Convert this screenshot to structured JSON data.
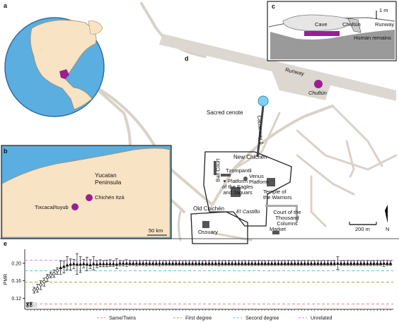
{
  "panels": {
    "a": "a",
    "b": "b",
    "c": "c",
    "d": "d",
    "e": "e"
  },
  "map_d": {
    "runway": "Runway",
    "chultun": "Chultún",
    "sacred_cenote": "Sacred cenote",
    "causeway": "Causeway 1",
    "new_chichen": "New Chichén",
    "tzompantli": "Tzompantli",
    "ball_court": "Ball Court",
    "eagles": [
      "Platform",
      "of the Eagles",
      "and Jaguars"
    ],
    "venus": [
      "Venus",
      "Platform"
    ],
    "warriors": [
      "Temple of",
      "the Warriors"
    ],
    "el_castillo": "El Castillo",
    "thousand": [
      "Court of the",
      "Thousand",
      "Columns"
    ],
    "old_chichen": "Old Chichén",
    "market": "Market",
    "ossuary": "Ossuary",
    "scale": "200 m",
    "north": "N"
  },
  "map_b": {
    "yucatan": [
      "Yucatan",
      "Peninsula"
    ],
    "chichen": "Chichén Itzá",
    "tixcaca": "Tixcacal/tuyub",
    "scale": "50 km"
  },
  "map_c": {
    "scale": "1 m",
    "cave": "Cave",
    "chultun": "Chultún",
    "runway": "Runway",
    "human_remains": "Human remains"
  },
  "colors": {
    "purple": "#9b1f91",
    "land": "#f9e3c5",
    "water": "#6bbde5",
    "road": "#d9d2c9",
    "gray": "#9a9a9a"
  },
  "chart_data": {
    "type": "scatter",
    "ylabel": "PMR",
    "yticks": [
      0.12,
      0.16,
      0.2
    ],
    "ylim": [
      0.095,
      0.232
    ],
    "thresholds": [
      {
        "name": "Same/Twins",
        "value": 0.107,
        "color": "#f08080"
      },
      {
        "name": "First degree",
        "value": 0.157,
        "color": "#a8a832"
      },
      {
        "name": "Second degree",
        "value": 0.183,
        "color": "#4fc7c7"
      },
      {
        "name": "Unrelated",
        "value": 0.207,
        "color": "#d98ad9"
      }
    ],
    "points": [
      {
        "y": 0.106,
        "lo": 0.1,
        "hi": 0.11,
        "m": "x"
      },
      {
        "y": 0.107,
        "lo": 0.101,
        "hi": 0.111,
        "m": "x"
      },
      {
        "y": 0.139,
        "lo": 0.132,
        "hi": 0.145,
        "m": "d"
      },
      {
        "y": 0.142,
        "lo": 0.134,
        "hi": 0.152,
        "m": "d"
      },
      {
        "y": 0.151,
        "lo": 0.14,
        "hi": 0.16,
        "m": "d"
      },
      {
        "y": 0.158,
        "lo": 0.148,
        "hi": 0.166,
        "m": "d"
      },
      {
        "y": 0.168,
        "lo": 0.159,
        "hi": 0.175,
        "m": "d"
      },
      {
        "y": 0.173,
        "lo": 0.167,
        "hi": 0.18,
        "m": "d"
      },
      {
        "y": 0.176,
        "lo": 0.168,
        "hi": 0.185,
        "m": "d"
      },
      {
        "y": 0.183,
        "lo": 0.175,
        "hi": 0.19,
        "m": "d"
      },
      {
        "y": 0.19,
        "lo": 0.175,
        "hi": 0.205,
        "m": "t"
      },
      {
        "y": 0.193,
        "lo": 0.178,
        "hi": 0.205,
        "m": "t"
      },
      {
        "y": 0.196,
        "lo": 0.185,
        "hi": 0.215,
        "m": "t"
      },
      {
        "y": 0.198,
        "lo": 0.185,
        "hi": 0.21,
        "m": "t"
      },
      {
        "y": 0.199,
        "lo": 0.188,
        "hi": 0.209,
        "m": "t"
      },
      {
        "y": 0.198,
        "lo": 0.175,
        "hi": 0.222,
        "m": "t"
      },
      {
        "y": 0.198,
        "lo": 0.179,
        "hi": 0.215,
        "m": "t"
      },
      {
        "y": 0.199,
        "lo": 0.19,
        "hi": 0.209,
        "m": "t"
      },
      {
        "y": 0.198,
        "lo": 0.183,
        "hi": 0.214,
        "m": "t"
      },
      {
        "y": 0.197,
        "lo": 0.188,
        "hi": 0.208,
        "m": "t"
      },
      {
        "y": 0.199,
        "lo": 0.185,
        "hi": 0.215,
        "m": "t"
      },
      {
        "y": 0.198,
        "lo": 0.19,
        "hi": 0.206,
        "m": "t"
      },
      {
        "y": 0.199,
        "lo": 0.192,
        "hi": 0.208,
        "m": "t"
      },
      {
        "y": 0.199,
        "lo": 0.192,
        "hi": 0.206,
        "m": "t"
      },
      {
        "y": 0.199,
        "lo": 0.192,
        "hi": 0.207,
        "m": "t"
      },
      {
        "y": 0.199,
        "lo": 0.193,
        "hi": 0.208,
        "m": "t"
      },
      {
        "y": 0.199,
        "lo": 0.193,
        "hi": 0.206,
        "m": "t"
      },
      {
        "y": 0.198,
        "lo": 0.188,
        "hi": 0.21,
        "m": "t"
      },
      {
        "y": 0.2,
        "lo": 0.194,
        "hi": 0.206,
        "m": "t"
      },
      {
        "y": 0.2,
        "lo": 0.194,
        "hi": 0.206,
        "m": "t"
      },
      {
        "y": 0.2,
        "lo": 0.193,
        "hi": 0.208,
        "m": "t"
      },
      {
        "y": 0.2,
        "lo": 0.195,
        "hi": 0.206,
        "m": "t"
      },
      {
        "y": 0.2,
        "lo": 0.195,
        "hi": 0.206,
        "m": "t"
      },
      {
        "y": 0.2,
        "lo": 0.194,
        "hi": 0.206,
        "m": "t"
      },
      {
        "y": 0.2,
        "lo": 0.195,
        "hi": 0.206,
        "m": "t"
      },
      {
        "y": 0.2,
        "lo": 0.195,
        "hi": 0.206,
        "m": "t"
      },
      {
        "y": 0.2,
        "lo": 0.194,
        "hi": 0.207,
        "m": "t"
      },
      {
        "y": 0.2,
        "lo": 0.195,
        "hi": 0.206,
        "m": "t"
      },
      {
        "y": 0.2,
        "lo": 0.195,
        "hi": 0.206,
        "m": "t"
      },
      {
        "y": 0.2,
        "lo": 0.195,
        "hi": 0.206,
        "m": "t"
      },
      {
        "y": 0.2,
        "lo": 0.194,
        "hi": 0.206,
        "m": "t"
      },
      {
        "y": 0.2,
        "lo": 0.195,
        "hi": 0.206,
        "m": "t"
      },
      {
        "y": 0.2,
        "lo": 0.195,
        "hi": 0.206,
        "m": "t"
      },
      {
        "y": 0.2,
        "lo": 0.195,
        "hi": 0.206,
        "m": "t"
      },
      {
        "y": 0.2,
        "lo": 0.195,
        "hi": 0.206,
        "m": "t"
      },
      {
        "y": 0.2,
        "lo": 0.195,
        "hi": 0.206,
        "m": "t"
      },
      {
        "y": 0.2,
        "lo": 0.195,
        "hi": 0.206,
        "m": "t"
      },
      {
        "y": 0.2,
        "lo": 0.195,
        "hi": 0.206,
        "m": "t"
      },
      {
        "y": 0.2,
        "lo": 0.195,
        "hi": 0.206,
        "m": "t"
      },
      {
        "y": 0.2,
        "lo": 0.195,
        "hi": 0.206,
        "m": "t"
      },
      {
        "y": 0.2,
        "lo": 0.195,
        "hi": 0.206,
        "m": "t"
      },
      {
        "y": 0.2,
        "lo": 0.195,
        "hi": 0.206,
        "m": "t"
      },
      {
        "y": 0.2,
        "lo": 0.195,
        "hi": 0.206,
        "m": "t"
      },
      {
        "y": 0.2,
        "lo": 0.195,
        "hi": 0.206,
        "m": "t"
      },
      {
        "y": 0.2,
        "lo": 0.195,
        "hi": 0.206,
        "m": "t"
      },
      {
        "y": 0.2,
        "lo": 0.195,
        "hi": 0.206,
        "m": "t"
      },
      {
        "y": 0.2,
        "lo": 0.195,
        "hi": 0.206,
        "m": "t"
      },
      {
        "y": 0.2,
        "lo": 0.195,
        "hi": 0.206,
        "m": "t"
      },
      {
        "y": 0.2,
        "lo": 0.194,
        "hi": 0.206,
        "m": "t"
      },
      {
        "y": 0.2,
        "lo": 0.195,
        "hi": 0.206,
        "m": "t"
      },
      {
        "y": 0.2,
        "lo": 0.195,
        "hi": 0.206,
        "m": "t"
      },
      {
        "y": 0.2,
        "lo": 0.195,
        "hi": 0.206,
        "m": "t"
      },
      {
        "y": 0.2,
        "lo": 0.195,
        "hi": 0.206,
        "m": "t"
      },
      {
        "y": 0.2,
        "lo": 0.195,
        "hi": 0.206,
        "m": "t"
      },
      {
        "y": 0.2,
        "lo": 0.195,
        "hi": 0.206,
        "m": "t"
      },
      {
        "y": 0.2,
        "lo": 0.195,
        "hi": 0.206,
        "m": "t"
      },
      {
        "y": 0.2,
        "lo": 0.195,
        "hi": 0.206,
        "m": "t"
      },
      {
        "y": 0.2,
        "lo": 0.195,
        "hi": 0.206,
        "m": "t"
      },
      {
        "y": 0.2,
        "lo": 0.195,
        "hi": 0.206,
        "m": "t"
      },
      {
        "y": 0.2,
        "lo": 0.195,
        "hi": 0.206,
        "m": "t"
      },
      {
        "y": 0.2,
        "lo": 0.195,
        "hi": 0.206,
        "m": "t"
      },
      {
        "y": 0.2,
        "lo": 0.195,
        "hi": 0.206,
        "m": "t"
      },
      {
        "y": 0.2,
        "lo": 0.195,
        "hi": 0.206,
        "m": "t"
      },
      {
        "y": 0.2,
        "lo": 0.195,
        "hi": 0.206,
        "m": "t"
      },
      {
        "y": 0.2,
        "lo": 0.195,
        "hi": 0.206,
        "m": "t"
      },
      {
        "y": 0.2,
        "lo": 0.195,
        "hi": 0.206,
        "m": "t"
      },
      {
        "y": 0.2,
        "lo": 0.195,
        "hi": 0.206,
        "m": "t"
      },
      {
        "y": 0.2,
        "lo": 0.195,
        "hi": 0.206,
        "m": "t"
      },
      {
        "y": 0.2,
        "lo": 0.195,
        "hi": 0.206,
        "m": "t"
      },
      {
        "y": 0.2,
        "lo": 0.195,
        "hi": 0.206,
        "m": "t"
      },
      {
        "y": 0.2,
        "lo": 0.195,
        "hi": 0.206,
        "m": "t"
      },
      {
        "y": 0.2,
        "lo": 0.195,
        "hi": 0.206,
        "m": "t"
      },
      {
        "y": 0.2,
        "lo": 0.195,
        "hi": 0.206,
        "m": "t"
      },
      {
        "y": 0.2,
        "lo": 0.195,
        "hi": 0.206,
        "m": "t"
      },
      {
        "y": 0.2,
        "lo": 0.195,
        "hi": 0.206,
        "m": "t"
      },
      {
        "y": 0.2,
        "lo": 0.195,
        "hi": 0.206,
        "m": "t"
      },
      {
        "y": 0.2,
        "lo": 0.195,
        "hi": 0.206,
        "m": "t"
      },
      {
        "y": 0.2,
        "lo": 0.195,
        "hi": 0.206,
        "m": "t"
      },
      {
        "y": 0.2,
        "lo": 0.195,
        "hi": 0.206,
        "m": "t"
      },
      {
        "y": 0.2,
        "lo": 0.195,
        "hi": 0.206,
        "m": "t"
      },
      {
        "y": 0.2,
        "lo": 0.195,
        "hi": 0.206,
        "m": "t"
      },
      {
        "y": 0.2,
        "lo": 0.195,
        "hi": 0.206,
        "m": "t"
      },
      {
        "y": 0.2,
        "lo": 0.195,
        "hi": 0.206,
        "m": "t"
      },
      {
        "y": 0.2,
        "lo": 0.195,
        "hi": 0.206,
        "m": "t"
      },
      {
        "y": 0.2,
        "lo": 0.186,
        "hi": 0.215,
        "m": "t"
      },
      {
        "y": 0.2,
        "lo": 0.195,
        "hi": 0.206,
        "m": "t"
      },
      {
        "y": 0.2,
        "lo": 0.195,
        "hi": 0.206,
        "m": "t"
      },
      {
        "y": 0.2,
        "lo": 0.195,
        "hi": 0.206,
        "m": "t"
      },
      {
        "y": 0.2,
        "lo": 0.195,
        "hi": 0.206,
        "m": "t"
      },
      {
        "y": 0.2,
        "lo": 0.195,
        "hi": 0.206,
        "m": "t"
      },
      {
        "y": 0.2,
        "lo": 0.195,
        "hi": 0.206,
        "m": "t"
      },
      {
        "y": 0.2,
        "lo": 0.195,
        "hi": 0.206,
        "m": "t"
      },
      {
        "y": 0.2,
        "lo": 0.195,
        "hi": 0.206,
        "m": "t"
      },
      {
        "y": 0.2,
        "lo": 0.195,
        "hi": 0.206,
        "m": "t"
      },
      {
        "y": 0.2,
        "lo": 0.195,
        "hi": 0.206,
        "m": "t"
      },
      {
        "y": 0.2,
        "lo": 0.195,
        "hi": 0.206,
        "m": "t"
      },
      {
        "y": 0.2,
        "lo": 0.195,
        "hi": 0.206,
        "m": "t"
      },
      {
        "y": 0.2,
        "lo": 0.195,
        "hi": 0.206,
        "m": "t"
      },
      {
        "y": 0.2,
        "lo": 0.193,
        "hi": 0.207,
        "m": "t"
      },
      {
        "y": 0.2,
        "lo": 0.195,
        "hi": 0.206,
        "m": "t"
      },
      {
        "y": 0.2,
        "lo": 0.195,
        "hi": 0.206,
        "m": "t"
      }
    ]
  }
}
